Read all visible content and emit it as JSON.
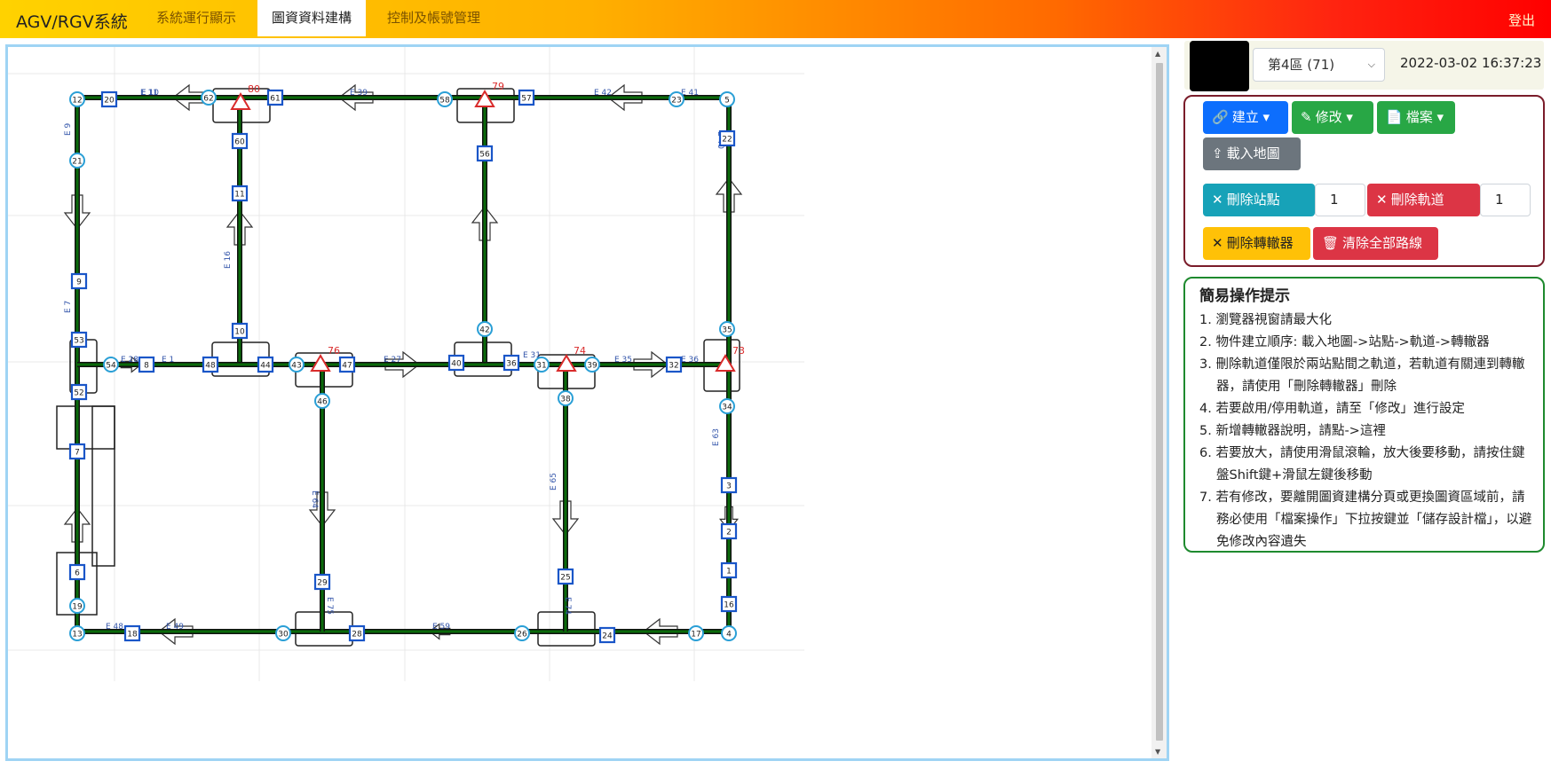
{
  "navbar": {
    "brand": "AGV/RGV系統",
    "items": [
      "系統運行顯示",
      "圖資資料建構",
      "控制及帳號管理"
    ],
    "active_index": 1,
    "logout": "登出",
    "gradient_colors": [
      "#ffd200",
      "#ffb000",
      "#ff6a00",
      "#ff0000"
    ]
  },
  "toolbar": {
    "zone_select_value": "第4區 (71)",
    "datetime": "2022-03-02 16:37:23"
  },
  "tools": {
    "create_label": "建立",
    "edit_label": "修改",
    "file_label": "檔案",
    "load_map_label": "載入地圖",
    "delete_station_label": "刪除站點",
    "delete_station_value": "1",
    "delete_track_label": "刪除軌道",
    "delete_track_value": "1",
    "delete_converter_label": "刪除轉轍器",
    "clear_all_label": "清除全部路線",
    "colors": {
      "create": "#0d6efd",
      "edit": "#28a745",
      "file": "#28a745",
      "load_map": "#6c757d",
      "delete_station": "#17a2b8",
      "delete_track": "#dc3545",
      "delete_converter": "#ffc107",
      "clear_all": "#dc3545"
    }
  },
  "hints": {
    "title": "簡易操作提示",
    "items": [
      "1. 瀏覽器視窗請最大化",
      "2. 物件建立順序: 載入地圖->站點->軌道->轉轍器",
      "3. 刪除軌道僅限於兩站點間之軌道，若軌道有關連到轉轍器，請使用「刪除轉轍器」刪除",
      "4. 若要啟用/停用軌道，請至「修改」進行設定",
      "5. 新增轉轍器說明，請點->這裡",
      "6. 若要放大，請使用滑鼠滾輪，放大後要移動，請按住鍵盤Shift鍵+滑鼠左鍵後移動",
      "7. 若有修改，要離開圖資建構分頁或更換圖資區域前，請務必使用「檔案操作」下拉按鍵並「儲存設計檔」，以避免修改內容遺失"
    ]
  },
  "map": {
    "track_color": "#0a6a0a",
    "station_color": "#1a56c8",
    "node_color": "#2a9fd6",
    "converter_color": "#d92b2b",
    "stations": [
      "20",
      "60",
      "11",
      "10",
      "61",
      "57",
      "56",
      "22",
      "9",
      "53",
      "52",
      "8",
      "48",
      "44",
      "47",
      "40",
      "36",
      "32",
      "7",
      "6",
      "18",
      "29",
      "28",
      "25",
      "24",
      "3",
      "2",
      "1",
      "16"
    ],
    "nodes": [
      "12",
      "21",
      "62",
      "58",
      "23",
      "5",
      "54",
      "43",
      "42",
      "31",
      "39",
      "35",
      "34",
      "46",
      "38",
      "19",
      "13",
      "30",
      "26",
      "17",
      "4"
    ],
    "converters": [
      {
        "id": "80",
        "label": "80"
      },
      {
        "id": "79",
        "label": "79"
      },
      {
        "id": "76",
        "label": "76"
      },
      {
        "id": "74",
        "label": "74"
      },
      {
        "id": "73",
        "label": "73"
      }
    ],
    "edge_labels": [
      "E 10",
      "E 11",
      "E 39",
      "E 42",
      "E 41",
      "E 9",
      "E 16",
      "E 7",
      "E 28",
      "E 1",
      "E 27",
      "E 31",
      "E 35",
      "E 36",
      "E 40",
      "E 63",
      "E 64",
      "E 65",
      "E 75",
      "E 74",
      "E 48",
      "E 49",
      "E 59"
    ]
  }
}
